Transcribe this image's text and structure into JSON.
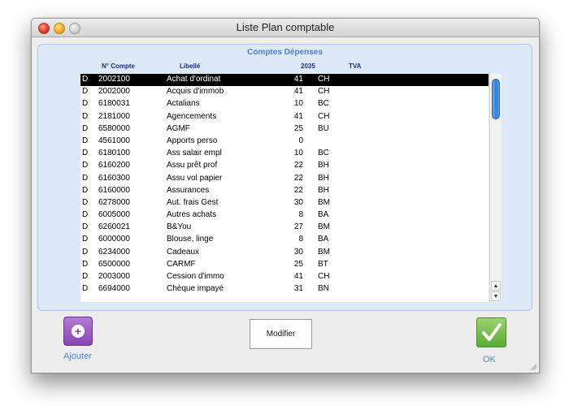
{
  "window": {
    "title": "Liste Plan comptable"
  },
  "panel": {
    "section_title": "Comptes Dépenses",
    "columns": {
      "compte": "N° Compte",
      "libelle": "Libellé",
      "col2035": "2035",
      "tva": "TVA"
    },
    "rows": [
      {
        "type": "D",
        "compte": "2002100",
        "libelle": "Achat d'ordinat",
        "v2035": "41",
        "code": "CH"
      },
      {
        "type": "D",
        "compte": "2002000",
        "libelle": "Acquis d'immob",
        "v2035": "41",
        "code": "CH"
      },
      {
        "type": "D",
        "compte": "6180031",
        "libelle": "Actalians",
        "v2035": "10",
        "code": "BC"
      },
      {
        "type": "D",
        "compte": "2181000",
        "libelle": "Agencements",
        "v2035": "41",
        "code": "CH"
      },
      {
        "type": "D",
        "compte": "6580000",
        "libelle": "AGMF",
        "v2035": "25",
        "code": "BU"
      },
      {
        "type": "D",
        "compte": "4561000",
        "libelle": "Apports perso",
        "v2035": "0",
        "code": ""
      },
      {
        "type": "D",
        "compte": "6180100",
        "libelle": "Ass salair empl",
        "v2035": "10",
        "code": "BC"
      },
      {
        "type": "D",
        "compte": "6160200",
        "libelle": "Assu prêt prof",
        "v2035": "22",
        "code": "BH"
      },
      {
        "type": "D",
        "compte": "6160300",
        "libelle": "Assu vol papier",
        "v2035": "22",
        "code": "BH"
      },
      {
        "type": "D",
        "compte": "6160000",
        "libelle": "Assurances",
        "v2035": "22",
        "code": "BH"
      },
      {
        "type": "D",
        "compte": "6278000",
        "libelle": "Aut. frais Gest",
        "v2035": "30",
        "code": "BM"
      },
      {
        "type": "D",
        "compte": "6005000",
        "libelle": "Autres achats",
        "v2035": "8",
        "code": "BA"
      },
      {
        "type": "D",
        "compte": "6260021",
        "libelle": "B&You",
        "v2035": "27",
        "code": "BM"
      },
      {
        "type": "D",
        "compte": "6000000",
        "libelle": "Blouse, linge",
        "v2035": "8",
        "code": "BA"
      },
      {
        "type": "D",
        "compte": "6234000",
        "libelle": "Cadeaux",
        "v2035": "30",
        "code": "BM"
      },
      {
        "type": "D",
        "compte": "6500000",
        "libelle": "CARMF",
        "v2035": "25",
        "code": "BT"
      },
      {
        "type": "D",
        "compte": "2003000",
        "libelle": "Cession d'immo",
        "v2035": "41",
        "code": "CH"
      },
      {
        "type": "D",
        "compte": "6694000",
        "libelle": "Chèque impayé",
        "v2035": "31",
        "code": "BN"
      }
    ],
    "selected_row": 0
  },
  "actions": {
    "add_label": "Ajouter",
    "modify_label": "Modifier",
    "ok_label": "OK"
  },
  "colors": {
    "panel_bg": "#dde9f7",
    "header_blue": "#1a2f86",
    "link_blue": "#4e86c8",
    "add_purple": "#8a45b3",
    "ok_green": "#5bab36"
  }
}
